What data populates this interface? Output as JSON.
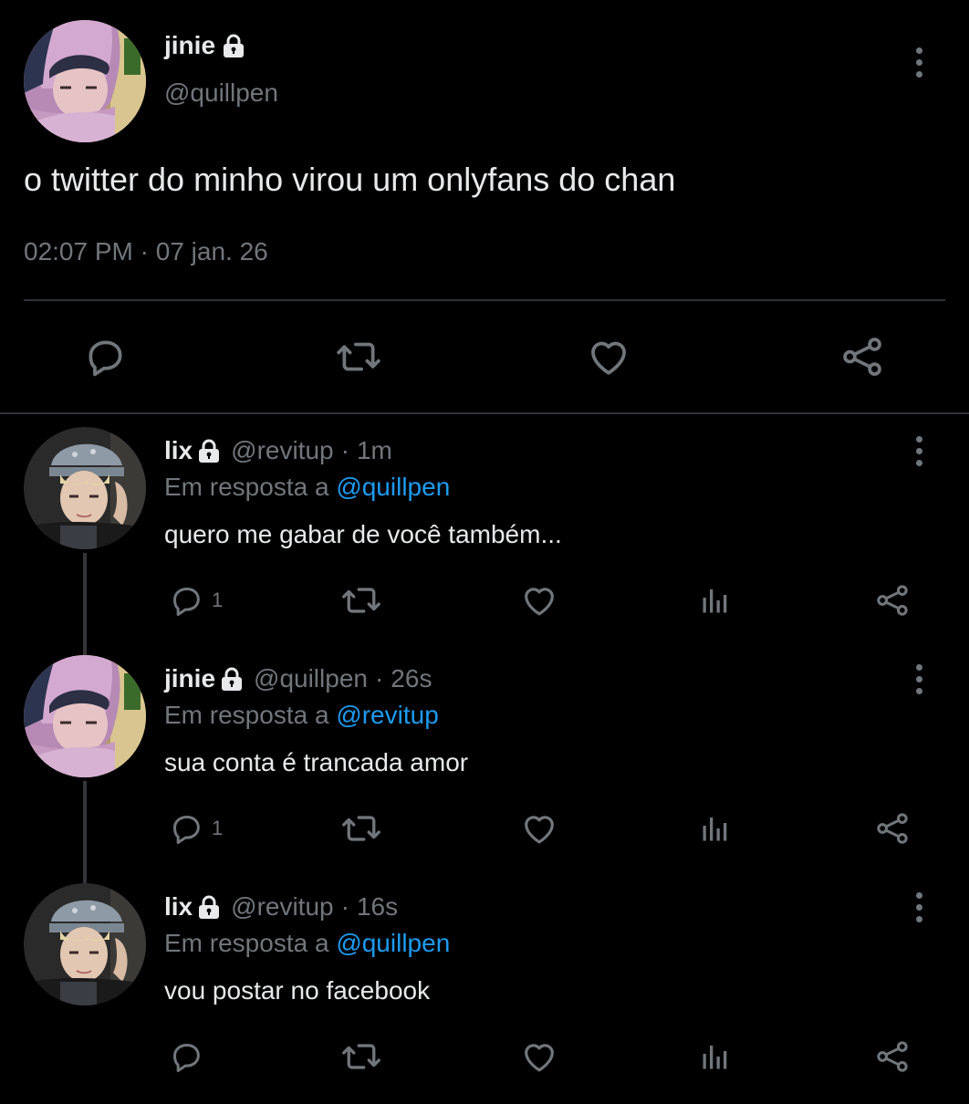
{
  "main_tweet": {
    "display_name": "jinie",
    "handle": "@quillpen",
    "text": "o twitter do minho virou um onlyfans do chan",
    "time": "02:07 PM",
    "separator": "·",
    "date": "07 jan. 26",
    "avatar_icon": "avatar-photo-pink-hood",
    "actions": [
      "reply-icon",
      "retweet-icon",
      "like-icon",
      "share-icon"
    ]
  },
  "replies": [
    {
      "display_name": "lix",
      "handle": "@revitup",
      "separator": "·",
      "time": "1m",
      "reply_prefix": "Em resposta a",
      "reply_mention": "@quillpen",
      "text": "quero me gabar de você também...",
      "reply_count": "1",
      "avatar_icon": "avatar-photo-grey-beanie"
    },
    {
      "display_name": "jinie",
      "handle": "@quillpen",
      "separator": "·",
      "time": "26s",
      "reply_prefix": "Em resposta a",
      "reply_mention": "@revitup",
      "text": "sua conta é trancada amor",
      "reply_count": "1",
      "avatar_icon": "avatar-photo-pink-hood"
    },
    {
      "display_name": "lix",
      "handle": "@revitup",
      "separator": "·",
      "time": "16s",
      "reply_prefix": "Em resposta a",
      "reply_mention": "@quillpen",
      "text": "vou postar no facebook",
      "reply_count": "",
      "avatar_icon": "avatar-photo-grey-beanie"
    }
  ],
  "colors": {
    "background": "#000000",
    "text_primary": "#e7e9ea",
    "text_secondary": "#71767b",
    "link": "#1d9bf0",
    "divider": "#2f3336"
  }
}
